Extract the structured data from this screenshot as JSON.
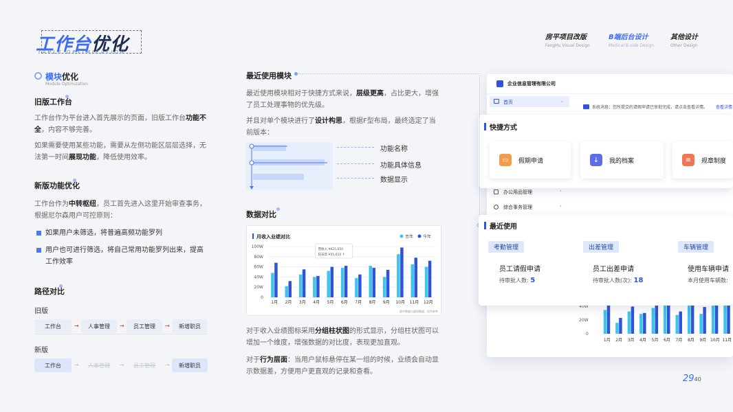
{
  "header": {
    "title_a": "工作台",
    "title_b": "优化",
    "title_en": "TABLE OPTIMIZATION",
    "nav": [
      {
        "label": "房平项目改版",
        "sub": "FangHu Visual Design"
      },
      {
        "label": "B端后台设计",
        "sub": "Medical B-side Design"
      },
      {
        "label": "其他设计",
        "sub": "Other Design"
      }
    ]
  },
  "left": {
    "module_title_a": "模块",
    "module_title_b": "优化",
    "module_sub": "Module Optimization",
    "old_title": "旧版工作台",
    "old_p1_a": "工作台作为平台进入首先展示的页面，旧版工作台",
    "old_p1_b": "功能不全",
    "old_p1_c": "，内容不够完善。",
    "old_p2_a": "如果需要使用某些功能，需要从左侧功能区层层选择，无法第一时间",
    "old_p2_b": "展现功能",
    "old_p2_c": "，降低使用效率。",
    "new_title": "新版功能优化",
    "new_p1_a": "工作台作为",
    "new_p1_b": "中转枢纽",
    "new_p1_c": "，员工首先进入这里开始审查事务，根据尼尔森用户可控原则：",
    "bullet1": "如果用户未筛选，将普遍高频功能罗列",
    "bullet2": "用户也可进行筛选，将自己常用功能罗列出来，提高工作效率",
    "path_title": "路径对比",
    "old_label": "旧版",
    "new_label": "新版",
    "old_flow": [
      "工作台",
      "人事管理",
      "员工管理",
      "新增职员"
    ],
    "new_flow": [
      "工作台",
      "人事管理",
      "员工管理",
      "新增职员"
    ],
    "arrow": "→"
  },
  "middle": {
    "recent_title": "最近使用模块",
    "recent_p1_a": "最近使用模块相对于快捷方式来说，",
    "recent_p1_b": "层级更高",
    "recent_p1_c": "，占比更大，增强了员工处理事物的优先级。",
    "recent_p2_a": "并且对单个模块进行了",
    "recent_p2_b": "设计构思",
    "recent_p2_c": "，根据F型布局，最终选定了当前版本：",
    "diag_labels": [
      "功能名称",
      "功能具体信息",
      "数据显示"
    ],
    "data_title": "数据对比",
    "data_p1_a": "对于收入业绩图标采用",
    "data_p1_b": "分组柱状图",
    "data_p1_c": "的形式显示，分组柱状图可以增加一个维度，增强数据的对比度，表现更加直观。",
    "data_p2_a": "对于",
    "data_p2_b": "行为层面",
    "data_p2_c": "：当用户鼠标悬停在某一组的时候，业绩会自动显示数据差，方便用户更直观的记录和查看。"
  },
  "chart_data": {
    "type": "bar",
    "title": "月收入业绩对比",
    "categories": [
      "1月",
      "2月",
      "3月",
      "4月",
      "5月",
      "6月",
      "7月",
      "8月",
      "9月",
      "10月",
      "11月",
      "12月"
    ],
    "series": [
      {
        "name": "去年",
        "values": [
          48,
          22,
          45,
          40,
          52,
          58,
          38,
          62,
          40,
          85,
          65,
          60
        ],
        "color": "#3ec4ee"
      },
      {
        "name": "今年",
        "values": [
          68,
          32,
          55,
          42,
          60,
          62,
          45,
          58,
          54,
          98,
          78,
          72
        ],
        "color": "#2f54d6"
      }
    ],
    "yticks": [
      "0",
      "20W",
      "40W",
      "60W",
      "80W",
      "100W"
    ],
    "ylim": [
      0,
      100
    ],
    "tooltip": [
      "营收入 ¥625,650",
      "较去年 ¥55,610 ↑"
    ],
    "footnote": "图中数据为虚拟数据，仅供参考",
    "legend_position": "top-right"
  },
  "right": {
    "company": "企业信息管理有限公司",
    "menu_home": "首页",
    "notice": "系统消息：您所提交的请假申请已审批完成，请点击查看详情。",
    "notice_link": "查看详情",
    "menu_items": [
      "办公用品管理",
      "综合事务管理"
    ],
    "quick_title": "快捷方式",
    "quick_tiles": [
      {
        "label": "假期申请",
        "color": "#f49a4b",
        "icon": "calendar-icon"
      },
      {
        "label": "我的档案",
        "color": "#5b6ee8",
        "icon": "download-icon"
      },
      {
        "label": "规章制度",
        "color": "#f07656",
        "icon": "document-icon"
      }
    ],
    "recent_title": "最近使用",
    "recent_cards": [
      {
        "tag": "考勤管理",
        "title": "员工请假申请",
        "sub": "待审批人数:",
        "value": "5"
      },
      {
        "tag": "出差管理",
        "title": "员工出差申请",
        "sub": "待审批人数(次):",
        "value": "18"
      },
      {
        "tag": "车辆管理",
        "title": "使用车辆申请",
        "sub": "本月使用车辆数:",
        "value": ""
      }
    ]
  },
  "mini_chart": {
    "yticks": [
      "0",
      "20W",
      "40W"
    ],
    "categories": [
      "1月",
      "2月",
      "3月",
      "4月",
      "5月",
      "6月",
      "7月",
      "8月",
      "9月",
      "10月",
      "11月"
    ],
    "series": [
      {
        "name": "去年",
        "values": [
          48,
          22,
          45,
          40,
          52,
          58,
          38,
          62,
          40,
          85,
          65
        ],
        "color": "#3ec4ee"
      },
      {
        "name": "今年",
        "values": [
          68,
          32,
          55,
          42,
          60,
          62,
          45,
          58,
          54,
          98,
          78
        ],
        "color": "#2f54d6"
      }
    ]
  },
  "page": {
    "current": "29",
    "total": "40"
  }
}
